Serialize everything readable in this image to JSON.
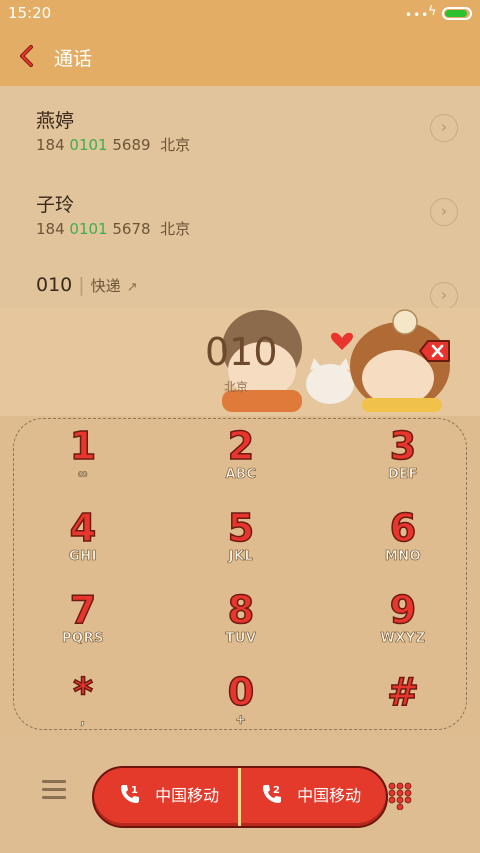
{
  "status_bar": {
    "time": "15:20",
    "battery_level": 0.9
  },
  "header": {
    "title": "通话"
  },
  "results": [
    {
      "name": "燕婷",
      "number_prefix": "184 ",
      "number_match": "0101",
      "number_suffix": " 5689",
      "location": "北京"
    },
    {
      "name": "子玲",
      "number_prefix": "184 ",
      "number_match": "0101",
      "number_suffix": " 5678",
      "location": "北京"
    },
    {
      "name": "010",
      "tag": "快递"
    }
  ],
  "display": {
    "digits": "010",
    "location": "北京"
  },
  "keys": [
    {
      "digit": "1",
      "letters": "∞"
    },
    {
      "digit": "2",
      "letters": "ABC"
    },
    {
      "digit": "3",
      "letters": "DEF"
    },
    {
      "digit": "4",
      "letters": "GHI"
    },
    {
      "digit": "5",
      "letters": "JKL"
    },
    {
      "digit": "6",
      "letters": "MNO"
    },
    {
      "digit": "7",
      "letters": "PQRS"
    },
    {
      "digit": "8",
      "letters": "TUV"
    },
    {
      "digit": "9",
      "letters": "WXYZ"
    },
    {
      "digit": "*",
      "letters": ","
    },
    {
      "digit": "0",
      "letters": "+"
    },
    {
      "digit": "#",
      "letters": ""
    }
  ],
  "call_buttons": {
    "sim1": {
      "badge": "1",
      "label": "中国移动"
    },
    "sim2": {
      "badge": "2",
      "label": "中国移动"
    }
  },
  "colors": {
    "accent": "#e3ad65",
    "key_red": "#e8352e",
    "match_green": "#3fae4f"
  }
}
